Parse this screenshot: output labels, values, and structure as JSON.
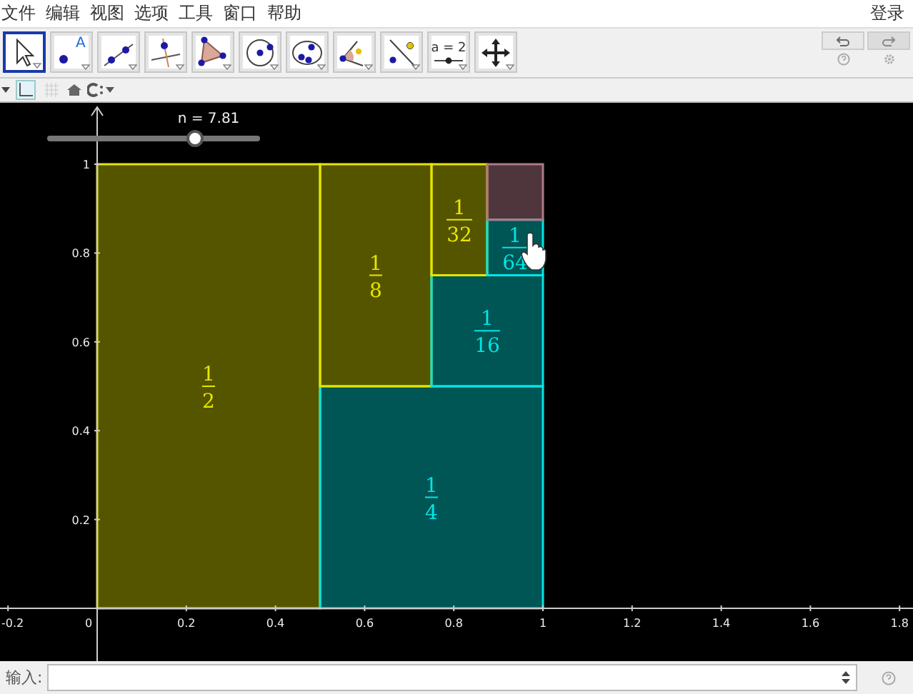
{
  "menu": {
    "items": [
      "文件",
      "编辑",
      "视图",
      "选项",
      "工具",
      "窗口",
      "帮助"
    ],
    "sign_in": "登录"
  },
  "toolbar": {
    "tools": [
      {
        "kind": "pointer",
        "selected": true
      },
      {
        "kind": "point",
        "selected": false,
        "caption": "A"
      },
      {
        "kind": "line",
        "selected": false
      },
      {
        "kind": "perpendicular",
        "selected": false
      },
      {
        "kind": "polygon",
        "selected": false
      },
      {
        "kind": "circle",
        "selected": false
      },
      {
        "kind": "conic",
        "selected": false
      },
      {
        "kind": "angle",
        "selected": false
      },
      {
        "kind": "reflect",
        "selected": false
      },
      {
        "kind": "slider",
        "selected": false,
        "caption": "a = 2"
      },
      {
        "kind": "move",
        "selected": false
      }
    ]
  },
  "style_bar": {
    "graphics_toggle_selected": true,
    "grid_selected": false
  },
  "graphics": {
    "slider": {
      "label": "n = 7.81",
      "level": 0.7
    },
    "x_axis_labels": [
      "-0.2",
      "0",
      "0.2",
      "0.4",
      "0.6",
      "0.8",
      "1",
      "1.2",
      "1.4",
      "1.6",
      "1.8"
    ],
    "y_axis_labels": [
      "1",
      "0.8",
      "0.6",
      "0.4",
      "0.2"
    ],
    "rectangles": [
      {
        "kind": "piece",
        "numerator": "1",
        "denominator": "2",
        "color": "#e6e600"
      },
      {
        "kind": "piece",
        "numerator": "1",
        "denominator": "4",
        "color": "#00e6e6"
      },
      {
        "kind": "piece",
        "numerator": "1",
        "denominator": "8",
        "color": "#e6e600"
      },
      {
        "kind": "piece",
        "numerator": "1",
        "denominator": "16",
        "color": "#00e6e6"
      },
      {
        "kind": "piece",
        "numerator": "1",
        "denominator": "32",
        "color": "#e6e600"
      },
      {
        "kind": "piece",
        "numerator": "1",
        "denominator": "64",
        "color": "#00e6e6"
      },
      {
        "kind": "remainder",
        "color": "#b07888"
      }
    ]
  },
  "input_bar": {
    "label": "输入:"
  }
}
